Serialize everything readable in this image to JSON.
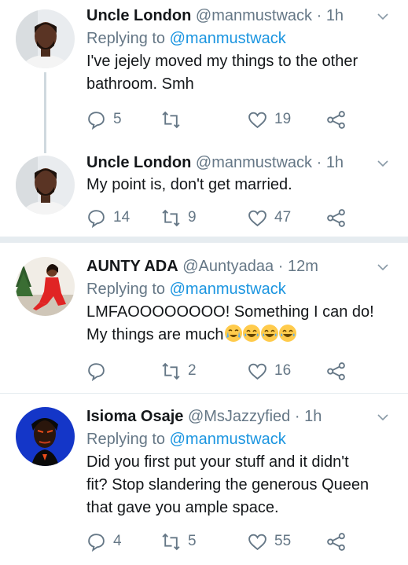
{
  "tweets": [
    {
      "name": "Uncle London",
      "handle": "@manmustwack",
      "time": "1h",
      "replying_prefix": "Replying to ",
      "replying_to": "@manmustwack",
      "text_lines": [
        "I've jejely moved my things to the other",
        "bathroom. Smh"
      ],
      "reply_count": "5",
      "retweet_count": "",
      "like_count": "19"
    },
    {
      "name": "Uncle London",
      "handle": "@manmustwack",
      "time": "1h",
      "text_lines": [
        "My point is, don't get married."
      ],
      "reply_count": "14",
      "retweet_count": "9",
      "like_count": "47"
    },
    {
      "name": "AUNTY ADA",
      "handle": "@Auntyadaa",
      "time": "12m",
      "replying_prefix": "Replying to ",
      "replying_to": "@manmustwack",
      "text_lines": [
        "LMFAOOOOOOOO! Something I can do!",
        "My things are much"
      ],
      "reply_count": "",
      "retweet_count": "2",
      "like_count": "16"
    },
    {
      "name": "Isioma Osaje",
      "handle": "@MsJazzyfied",
      "time": "1h",
      "replying_prefix": "Replying to ",
      "replying_to": "@manmustwack",
      "text_lines": [
        "Did you first put your stuff and it didn't",
        "fit? Stop slandering the generous Queen",
        "that gave you ample space."
      ],
      "reply_count": "4",
      "retweet_count": "5",
      "like_count": "55"
    }
  ],
  "separator_dot": "·",
  "icons": [
    "reply-icon",
    "retweet-icon",
    "like-icon",
    "share-icon",
    "chevron-down-icon",
    "crying-laughing-emoji",
    "tears-of-joy-emoji"
  ],
  "colors": {
    "text": "#14171a",
    "muted": "#657786",
    "link": "#1b95e0",
    "divider": "#e6ecf0"
  }
}
